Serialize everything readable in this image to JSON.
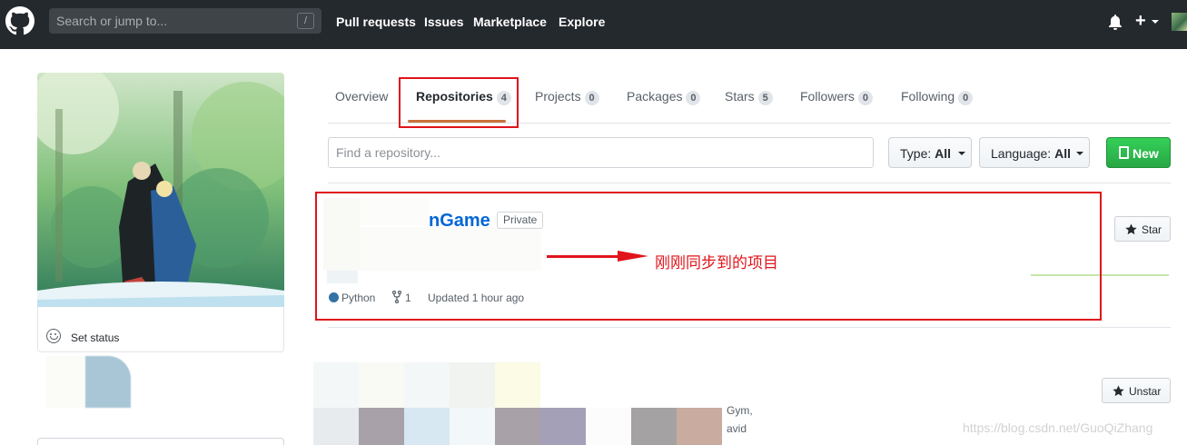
{
  "header": {
    "search_placeholder": "Search or jump to...",
    "search_shortcut": "/",
    "nav": [
      "Pull requests",
      "Issues",
      "Marketplace",
      "Explore"
    ]
  },
  "sidebar": {
    "set_status": "Set status"
  },
  "tabs": [
    {
      "label": "Overview",
      "count": null
    },
    {
      "label": "Repositories",
      "count": "4",
      "active": true
    },
    {
      "label": "Projects",
      "count": "0"
    },
    {
      "label": "Packages",
      "count": "0"
    },
    {
      "label": "Stars",
      "count": "5"
    },
    {
      "label": "Followers",
      "count": "0"
    },
    {
      "label": "Following",
      "count": "0"
    }
  ],
  "filters": {
    "repo_search_placeholder": "Find a repository...",
    "type_label": "Type:",
    "type_value": "All",
    "language_label": "Language:",
    "language_value": "All",
    "new_label": "New"
  },
  "repos": [
    {
      "name_visible": "nGame",
      "visibility": "Private",
      "language": "Python",
      "language_color": "#3572a5",
      "forks": "1",
      "updated": "Updated 1 hour ago",
      "star_label": "Star"
    },
    {
      "unstar_label": "Unstar",
      "fragments": [
        "Gym,",
        "avid"
      ]
    }
  ],
  "annotation": "刚刚同步到的项目",
  "watermark": "https://blog.csdn.net/GuoQiZhang",
  "colors": {
    "header_bg": "#24292e",
    "link": "#0366d6",
    "new_button": "#28a745",
    "highlight_red": "#e0141a",
    "active_tab_underline": "#c9713b"
  }
}
